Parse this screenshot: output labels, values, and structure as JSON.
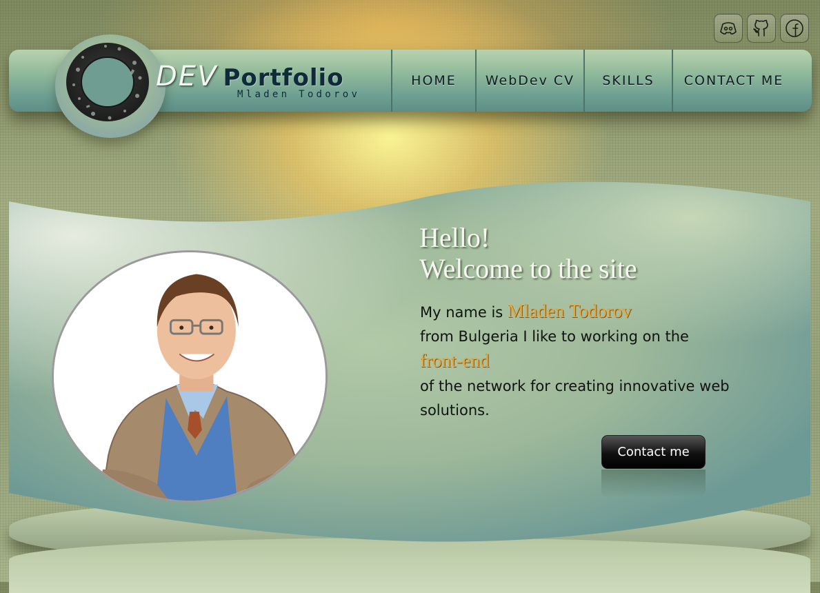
{
  "logo": {
    "dev": "DEV",
    "portfolio": "Portfolio",
    "subtitle": "Mladen Todorov"
  },
  "nav": {
    "items": [
      "HOME",
      "WebDev CV",
      "SKILLS",
      "CONTACT ME"
    ]
  },
  "social": {
    "icons": [
      "discord-icon",
      "github-icon",
      "facebook-icon"
    ]
  },
  "hero": {
    "greeting_line1": "Hello!",
    "greeting_line2": "Welcome to the site",
    "intro_prefix": "My name is",
    "name": "Mladen Todorov",
    "intro_line2": "from Bulgeria I like to working on the",
    "highlight": "front-end",
    "intro_line4": "of the network for creating innovative web",
    "intro_line5": "solutions.",
    "cta_label": "Contact me"
  },
  "colors": {
    "accent": "#e8a53a",
    "header_teal": "#6e9f92",
    "nav_text": "#0c1c22",
    "cta_black": "#000000"
  }
}
